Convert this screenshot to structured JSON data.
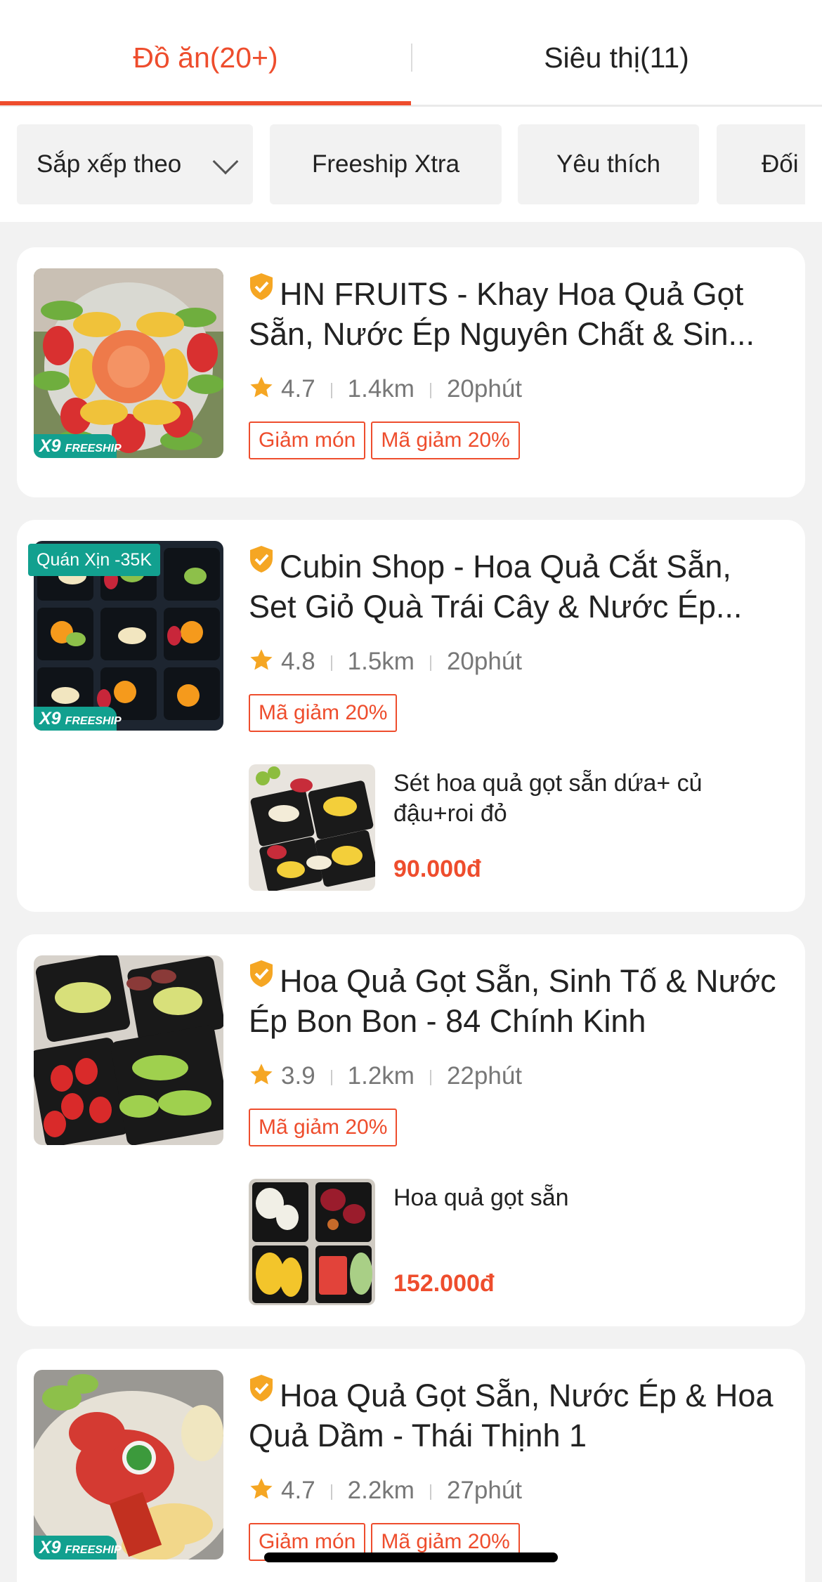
{
  "tabs": [
    {
      "label": "Đồ ăn(20+)",
      "active": true
    },
    {
      "label": "Siêu thị(11)",
      "active": false
    }
  ],
  "filters": {
    "sort": "Sắp xếp theo",
    "freeship": "Freeship Xtra",
    "favorite": "Yêu thích",
    "partner": "Đối"
  },
  "colors": {
    "accent": "#ee4d2d",
    "freeship_tag": "#12a08f",
    "star": "#f5a623",
    "verified": "#f5a623"
  },
  "icons": {
    "verified": "verified-shield-icon",
    "star": "star-icon",
    "chevron": "chevron-down-icon"
  },
  "freeship_badge": {
    "code": "X9",
    "text": "FREESHIP"
  },
  "stores": [
    {
      "name": "HN FRUITS - Khay Hoa Quả Gọt Sẵn, Nước Ép Nguyên Chất & Sin...",
      "rating": "4.7",
      "distance": "1.4km",
      "time": "20phút",
      "promos": [
        "Giảm món",
        "Mã giảm 20%"
      ]
    },
    {
      "name": "Cubin Shop - Hoa Quả Cắt Sẵn, Set Giỏ Quà Trái Cây & Nước Ép...",
      "deal_tag": "Quán Xịn -35K",
      "rating": "4.8",
      "distance": "1.5km",
      "time": "20phút",
      "promos": [
        "Mã giảm 20%"
      ],
      "dish": {
        "name": "Sét hoa quả gọt sẵn dứa+ củ đậu+roi đỏ",
        "price": "90.000đ"
      }
    },
    {
      "name": "Hoa Quả Gọt Sẵn, Sinh Tố & Nước Ép Bon Bon - 84 Chính Kinh",
      "rating": "3.9",
      "distance": "1.2km",
      "time": "22phút",
      "promos": [
        "Mã giảm 20%"
      ],
      "dish": {
        "name": "Hoa quả gọt sẵn",
        "price": "152.000đ"
      }
    },
    {
      "name": "Hoa Quả Gọt Sẵn, Nước Ép & Hoa Quả Dầm - Thái Thịnh 1",
      "rating": "4.7",
      "distance": "2.2km",
      "time": "27phút",
      "promos": [
        "Giảm món",
        "Mã giảm 20%"
      ]
    }
  ]
}
